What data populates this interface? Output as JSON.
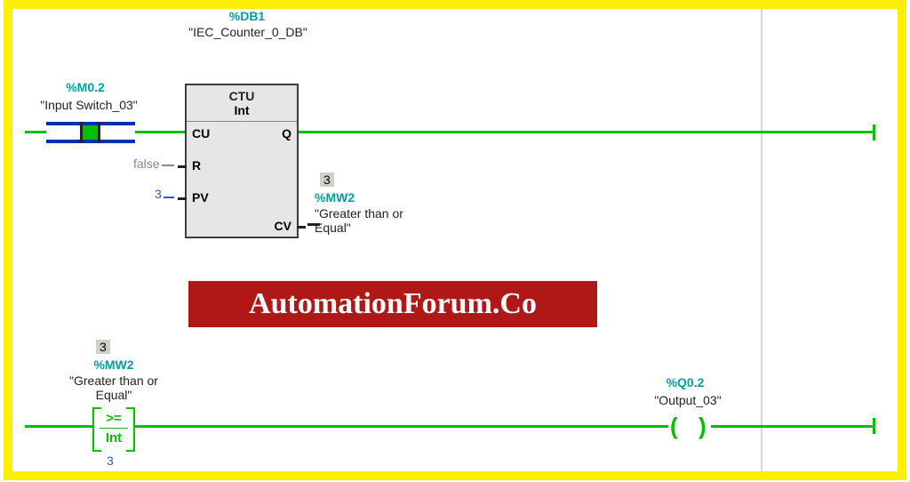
{
  "counter_db": {
    "addr": "%DB1",
    "name": "\"IEC_Counter_0_DB\""
  },
  "ctu": {
    "title": "CTU",
    "type": "Int",
    "pins": {
      "cu": "CU",
      "r": "R",
      "pv": "PV",
      "q": "Q",
      "cv": "CV"
    },
    "r_value": "false",
    "pv_value": "3"
  },
  "input_switch": {
    "addr": "%M0.2",
    "name": "\"Input Switch_03\""
  },
  "cv_out": {
    "value": "3",
    "addr": "%MW2",
    "name": "\"Greater than or Equal\""
  },
  "compare": {
    "value": "3",
    "addr": "%MW2",
    "name": "\"Greater than or Equal\"",
    "op": ">=",
    "type": "Int",
    "operand": "3"
  },
  "output": {
    "addr": "%Q0.2",
    "name": "\"Output_03\""
  },
  "watermark": "AutomationForum.Co"
}
